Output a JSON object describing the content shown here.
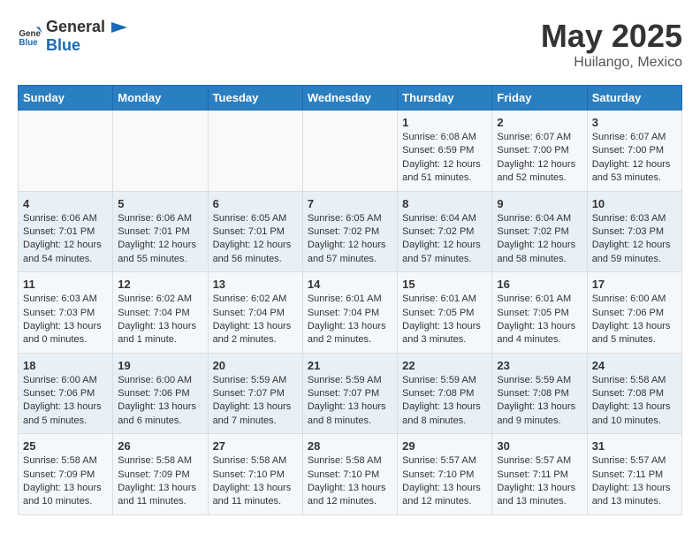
{
  "header": {
    "logo_general": "General",
    "logo_blue": "Blue",
    "main_title": "May 2025",
    "subtitle": "Huilango, Mexico"
  },
  "days_of_week": [
    "Sunday",
    "Monday",
    "Tuesday",
    "Wednesday",
    "Thursday",
    "Friday",
    "Saturday"
  ],
  "weeks": [
    [
      {
        "day": "",
        "content": ""
      },
      {
        "day": "",
        "content": ""
      },
      {
        "day": "",
        "content": ""
      },
      {
        "day": "",
        "content": ""
      },
      {
        "day": "1",
        "content": "Sunrise: 6:08 AM\nSunset: 6:59 PM\nDaylight: 12 hours\nand 51 minutes."
      },
      {
        "day": "2",
        "content": "Sunrise: 6:07 AM\nSunset: 7:00 PM\nDaylight: 12 hours\nand 52 minutes."
      },
      {
        "day": "3",
        "content": "Sunrise: 6:07 AM\nSunset: 7:00 PM\nDaylight: 12 hours\nand 53 minutes."
      }
    ],
    [
      {
        "day": "4",
        "content": "Sunrise: 6:06 AM\nSunset: 7:01 PM\nDaylight: 12 hours\nand 54 minutes."
      },
      {
        "day": "5",
        "content": "Sunrise: 6:06 AM\nSunset: 7:01 PM\nDaylight: 12 hours\nand 55 minutes."
      },
      {
        "day": "6",
        "content": "Sunrise: 6:05 AM\nSunset: 7:01 PM\nDaylight: 12 hours\nand 56 minutes."
      },
      {
        "day": "7",
        "content": "Sunrise: 6:05 AM\nSunset: 7:02 PM\nDaylight: 12 hours\nand 57 minutes."
      },
      {
        "day": "8",
        "content": "Sunrise: 6:04 AM\nSunset: 7:02 PM\nDaylight: 12 hours\nand 57 minutes."
      },
      {
        "day": "9",
        "content": "Sunrise: 6:04 AM\nSunset: 7:02 PM\nDaylight: 12 hours\nand 58 minutes."
      },
      {
        "day": "10",
        "content": "Sunrise: 6:03 AM\nSunset: 7:03 PM\nDaylight: 12 hours\nand 59 minutes."
      }
    ],
    [
      {
        "day": "11",
        "content": "Sunrise: 6:03 AM\nSunset: 7:03 PM\nDaylight: 13 hours\nand 0 minutes."
      },
      {
        "day": "12",
        "content": "Sunrise: 6:02 AM\nSunset: 7:04 PM\nDaylight: 13 hours\nand 1 minute."
      },
      {
        "day": "13",
        "content": "Sunrise: 6:02 AM\nSunset: 7:04 PM\nDaylight: 13 hours\nand 2 minutes."
      },
      {
        "day": "14",
        "content": "Sunrise: 6:01 AM\nSunset: 7:04 PM\nDaylight: 13 hours\nand 2 minutes."
      },
      {
        "day": "15",
        "content": "Sunrise: 6:01 AM\nSunset: 7:05 PM\nDaylight: 13 hours\nand 3 minutes."
      },
      {
        "day": "16",
        "content": "Sunrise: 6:01 AM\nSunset: 7:05 PM\nDaylight: 13 hours\nand 4 minutes."
      },
      {
        "day": "17",
        "content": "Sunrise: 6:00 AM\nSunset: 7:06 PM\nDaylight: 13 hours\nand 5 minutes."
      }
    ],
    [
      {
        "day": "18",
        "content": "Sunrise: 6:00 AM\nSunset: 7:06 PM\nDaylight: 13 hours\nand 5 minutes."
      },
      {
        "day": "19",
        "content": "Sunrise: 6:00 AM\nSunset: 7:06 PM\nDaylight: 13 hours\nand 6 minutes."
      },
      {
        "day": "20",
        "content": "Sunrise: 5:59 AM\nSunset: 7:07 PM\nDaylight: 13 hours\nand 7 minutes."
      },
      {
        "day": "21",
        "content": "Sunrise: 5:59 AM\nSunset: 7:07 PM\nDaylight: 13 hours\nand 8 minutes."
      },
      {
        "day": "22",
        "content": "Sunrise: 5:59 AM\nSunset: 7:08 PM\nDaylight: 13 hours\nand 8 minutes."
      },
      {
        "day": "23",
        "content": "Sunrise: 5:59 AM\nSunset: 7:08 PM\nDaylight: 13 hours\nand 9 minutes."
      },
      {
        "day": "24",
        "content": "Sunrise: 5:58 AM\nSunset: 7:08 PM\nDaylight: 13 hours\nand 10 minutes."
      }
    ],
    [
      {
        "day": "25",
        "content": "Sunrise: 5:58 AM\nSunset: 7:09 PM\nDaylight: 13 hours\nand 10 minutes."
      },
      {
        "day": "26",
        "content": "Sunrise: 5:58 AM\nSunset: 7:09 PM\nDaylight: 13 hours\nand 11 minutes."
      },
      {
        "day": "27",
        "content": "Sunrise: 5:58 AM\nSunset: 7:10 PM\nDaylight: 13 hours\nand 11 minutes."
      },
      {
        "day": "28",
        "content": "Sunrise: 5:58 AM\nSunset: 7:10 PM\nDaylight: 13 hours\nand 12 minutes."
      },
      {
        "day": "29",
        "content": "Sunrise: 5:57 AM\nSunset: 7:10 PM\nDaylight: 13 hours\nand 12 minutes."
      },
      {
        "day": "30",
        "content": "Sunrise: 5:57 AM\nSunset: 7:11 PM\nDaylight: 13 hours\nand 13 minutes."
      },
      {
        "day": "31",
        "content": "Sunrise: 5:57 AM\nSunset: 7:11 PM\nDaylight: 13 hours\nand 13 minutes."
      }
    ]
  ]
}
